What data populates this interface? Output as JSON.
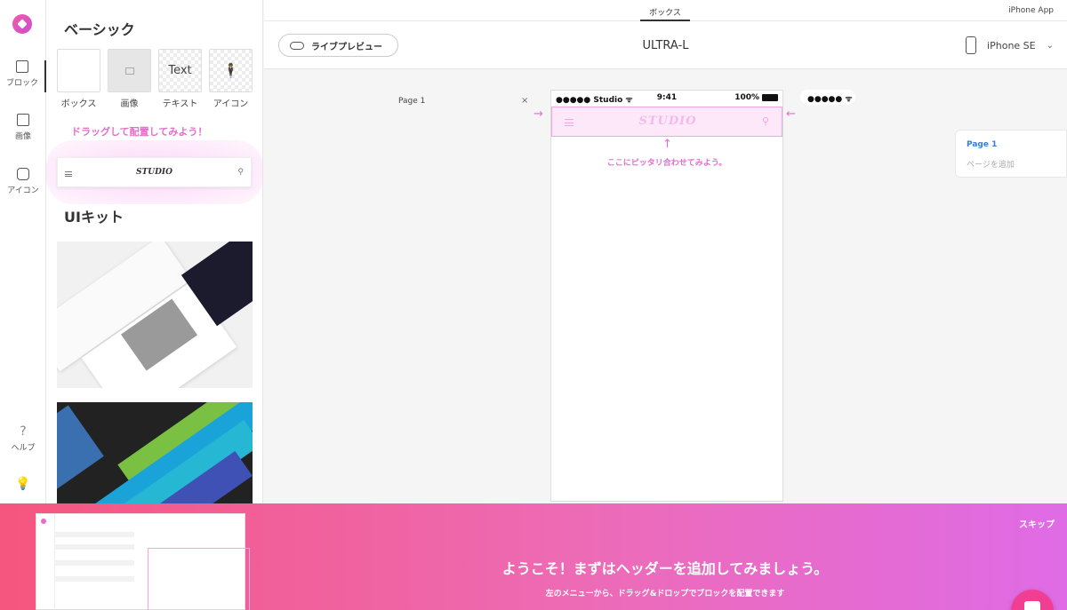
{
  "rail": {
    "items": [
      {
        "label": "ブロック"
      },
      {
        "label": "画像"
      },
      {
        "label": "アイコン"
      },
      {
        "label": "ヘルプ"
      }
    ]
  },
  "panel": {
    "basic_title": "ベーシック",
    "tiles": [
      {
        "label": "ボックス",
        "icon": "box-icon"
      },
      {
        "label": "画像",
        "icon": "image-icon"
      },
      {
        "label": "テキスト",
        "icon": "text-icon",
        "glyph": "Text"
      },
      {
        "label": "アイコン",
        "icon": "person-icon"
      }
    ],
    "drag_hint": "ドラッグして配置してみよう！",
    "header_block_logo": "STUDIO",
    "uikit_title": "UIキット"
  },
  "topbar": {
    "tab": "ボックス",
    "right": "iPhone App"
  },
  "toolbar": {
    "live_preview": "ライブプレビュー",
    "page_name": "ULTRA-L",
    "device": "iPhone SE"
  },
  "canvas": {
    "page_label": "Page 1",
    "close": "×",
    "status_left": "●●●●● Studio ᯤ",
    "status_time": "9:41",
    "status_battery": "100%",
    "header_logo": "STUDIO",
    "fit_text": "ここにピッタリ合わせてみよう。",
    "ext_status": "●●●●● ᯤ"
  },
  "pages": {
    "current": "Page 1",
    "add": "ページを追加"
  },
  "banner": {
    "skip": "スキップ",
    "title": "ようこそ！まずはヘッダーを追加してみましょう。",
    "subtitle": "左のメニューから、ドラッグ&ドロップでブロックを配置できます"
  },
  "colors": {
    "accent": "#e86ccc",
    "banner_start": "#f5567f",
    "banner_end": "#df6be6",
    "link": "#3a7bd5"
  }
}
